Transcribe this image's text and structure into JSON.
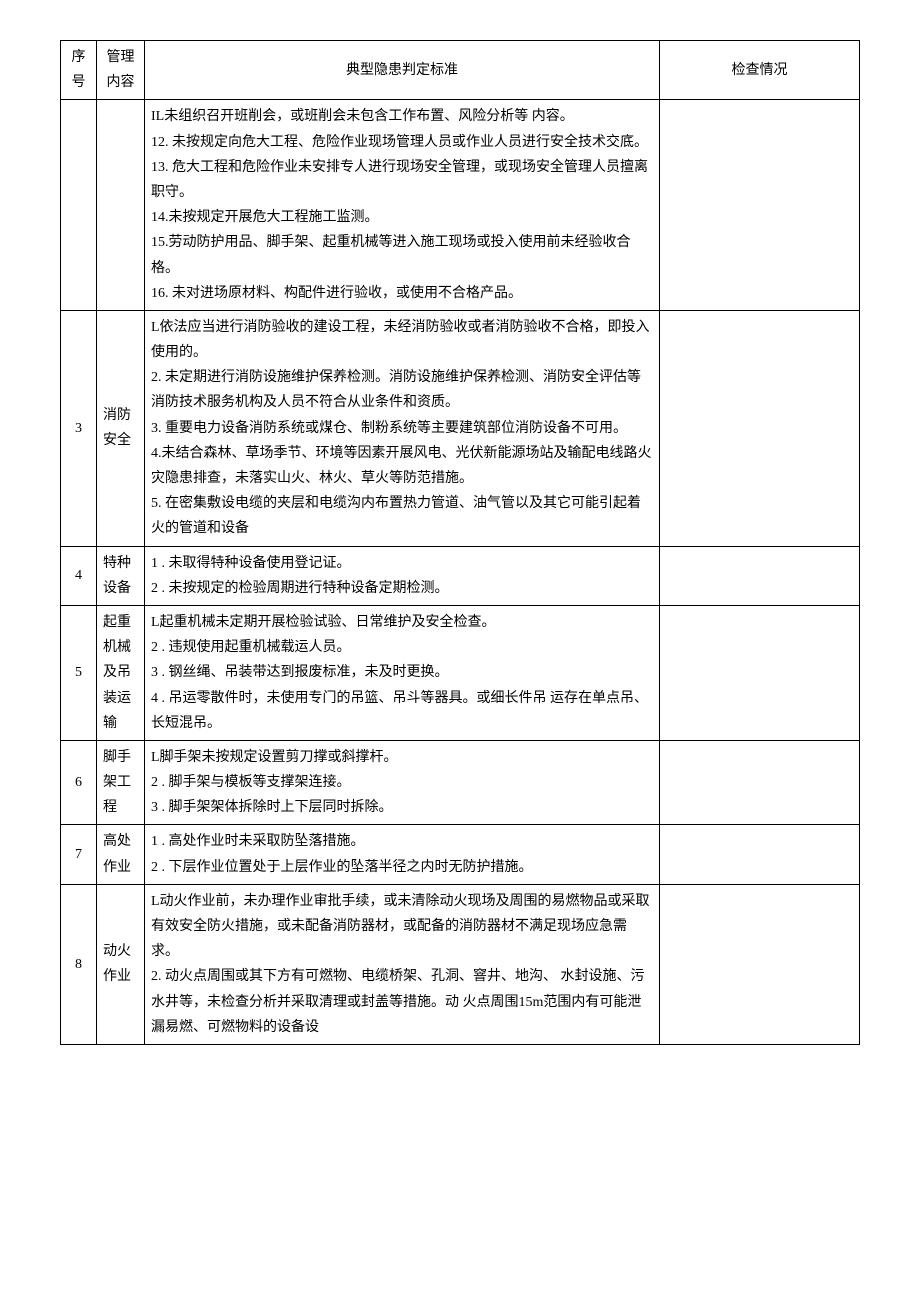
{
  "headers": {
    "num": "序号",
    "cat": "管理内容",
    "content": "典型隐患判定标准",
    "check": "检查情况"
  },
  "rows": [
    {
      "num": "",
      "cat": "",
      "content": "IL未组织召开班削会，或班削会未包含工作布置、风险分析等 内容。\n12. 未按规定向危大工程、危险作业现场管理人员或作业人员进行安全技术交底。\n13. 危大工程和危险作业未安排专人进行现场安全管理，或现场安全管理人员擅离职守。\n14.未按规定开展危大工程施工监测。\n15.劳动防护用品、脚手架、起重机械等进入施工现场或投入使用前未经验收合格。\n16. 未对进场原材料、构配件进行验收，或使用不合格产品。"
    },
    {
      "num": "3",
      "cat": "消防安全",
      "content": "L依法应当进行消防验收的建设工程，未经消防验收或者消防验收不合格，即投入使用的。\n2. 未定期进行消防设施维护保养检测。消防设施维护保养检测、消防安全评估等消防技术服务机构及人员不符合从业条件和资质。\n3. 重要电力设备消防系统或煤仓、制粉系统等主要建筑部位消防设备不可用。\n4.未结合森林、草场季节、环境等因素开展风电、光伏新能源场站及输配电线路火灾隐患排查，未落实山火、林火、草火等防范措施。\n5. 在密集敷设电缆的夹层和电缆沟内布置热力管道、油气管以及其它可能引起着火的管道和设备"
    },
    {
      "num": "4",
      "cat": "特种设备",
      "content": "1 . 未取得特种设备使用登记证。\n2 . 未按规定的检验周期进行特种设备定期检测。"
    },
    {
      "num": "5",
      "cat": "起重机械及吊装运输",
      "content": "L起重机械未定期开展检验试验、日常维护及安全检查。\n2 . 违规使用起重机械载运人员。\n3 . 钢丝绳、吊装带达到报废标准，未及时更换。\n4 . 吊运零散件时，未使用专门的吊篮、吊斗等器具。或细长件吊 运存在单点吊、长短混吊。"
    },
    {
      "num": "6",
      "cat": "脚手架工程",
      "content": "L脚手架未按规定设置剪刀撑或斜撑杆。\n2 . 脚手架与模板等支撑架连接。\n3 . 脚手架架体拆除时上下层同时拆除。"
    },
    {
      "num": "7",
      "cat": "高处作业",
      "content": "1 . 高处作业时未采取防坠落措施。\n2 . 下层作业位置处于上层作业的坠落半径之内时无防护措施。"
    },
    {
      "num": "8",
      "cat": "动火作业",
      "content": "L动火作业前，未办理作业审批手续，或未清除动火现场及周围的易燃物品或采取有效安全防火措施，或未配备消防器材，或配备的消防器材不满足现场应急需求。\n2. 动火点周围或其下方有可燃物、电缆桥架、孔洞、窨井、地沟、 水封设施、污水井等，未检查分析并采取清理或封盖等措施。动 火点周围15m范围内有可能泄漏易燃、可燃物料的设备设"
    }
  ]
}
